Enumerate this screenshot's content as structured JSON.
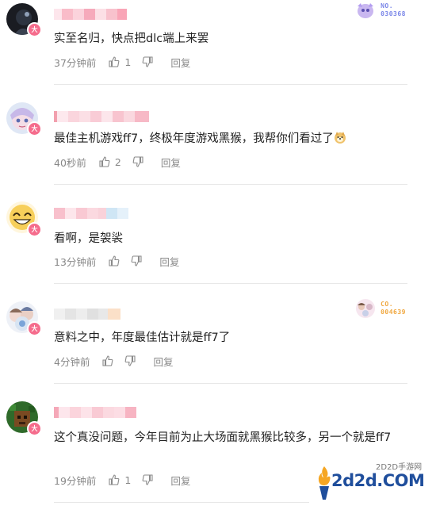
{
  "comments": [
    {
      "text": "实至名归，快点把dlc端上来罢",
      "time": "37分钟前",
      "likes": "1",
      "reply": "回复",
      "medal": {
        "line1": "NO.",
        "line2": "030368"
      }
    },
    {
      "text": "最佳主机游戏ff7，终极年度游戏黑猴，我帮你们看过了",
      "time": "40秒前",
      "likes": "2",
      "reply": "回复"
    },
    {
      "text": "看啊，是袈裟",
      "time": "13分钟前",
      "likes": "",
      "reply": "回复"
    },
    {
      "text": "意料之中，年度最佳估计就是ff7了",
      "time": "4分钟前",
      "likes": "",
      "reply": "回复",
      "medal": {
        "line1": "CO.",
        "line2": "004639"
      }
    },
    {
      "text": "这个真没问题，今年目前为止大场面就黑猴比较多，另一个就是ff7",
      "time": "19分钟前",
      "likes": "1",
      "reply": "回复"
    }
  ],
  "level_badge": "大",
  "watermark": {
    "logo": "2d2d.COM",
    "site": "2D2D手游网"
  },
  "colors": {
    "level_badge": "#f56c8c",
    "text": "#222222",
    "meta": "#888888",
    "divider": "#e8e8e8",
    "watermark_blue": "#1f4e9c"
  },
  "icons": [
    "thumb-up-icon",
    "thumb-down-icon",
    "doge-emoji-icon"
  ]
}
